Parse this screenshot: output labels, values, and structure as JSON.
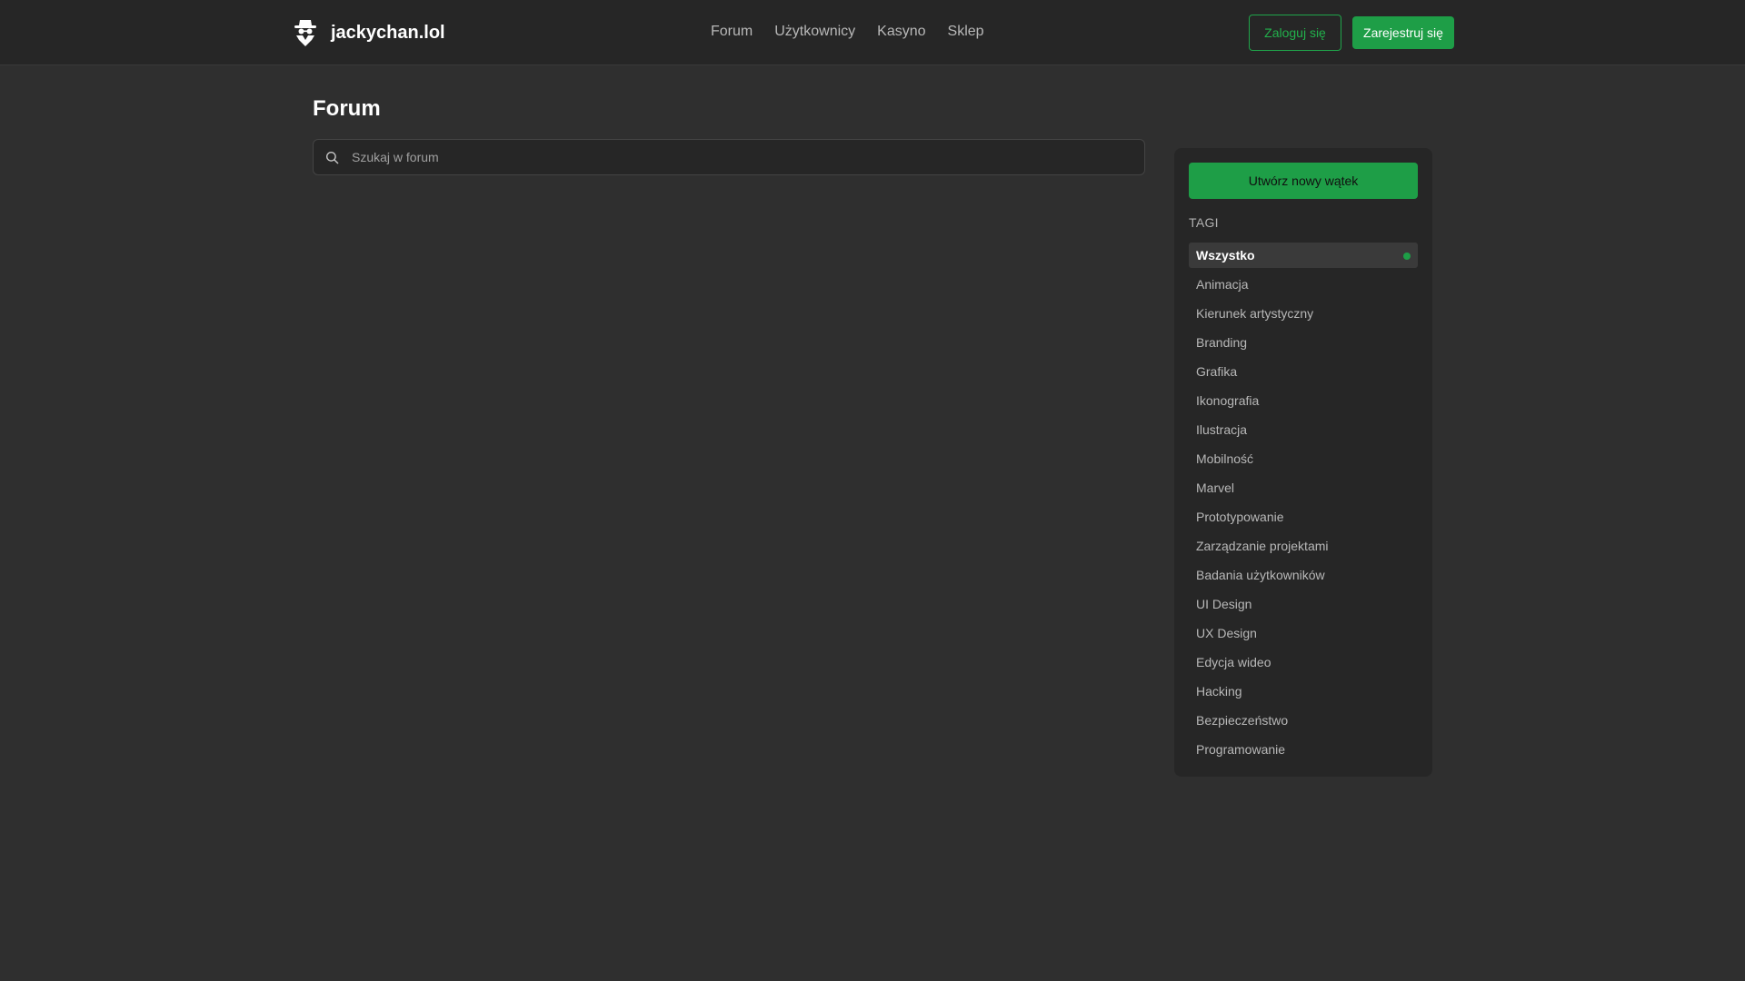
{
  "header": {
    "brand": "jackychan.lol",
    "nav": [
      "Forum",
      "Użytkownicy",
      "Kasyno",
      "Sklep"
    ],
    "login_label": "Zaloguj się",
    "register_label": "Zarejestruj się"
  },
  "main": {
    "title": "Forum",
    "search_placeholder": "Szukaj w forum",
    "search_value": ""
  },
  "sidebar": {
    "new_thread_label": "Utwórz nowy wątek",
    "tags_heading": "TAGI",
    "active_tag": "Wszystko",
    "tags": [
      "Wszystko",
      "Animacja",
      "Kierunek artystyczny",
      "Branding",
      "Grafika",
      "Ikonografia",
      "Ilustracja",
      "Mobilność",
      "Marvel",
      "Prototypowanie",
      "Zarządzanie projektami",
      "Badania użytkowników",
      "UI Design",
      "UX Design",
      "Edycja wideo",
      "Hacking",
      "Bezpieczeństwo",
      "Programowanie"
    ]
  },
  "colors": {
    "accent": "#1e9e47",
    "background": "#2f2f2f",
    "panel": "#262626"
  },
  "icons": {
    "logo": "incognito-agent-icon",
    "search": "search-icon"
  }
}
